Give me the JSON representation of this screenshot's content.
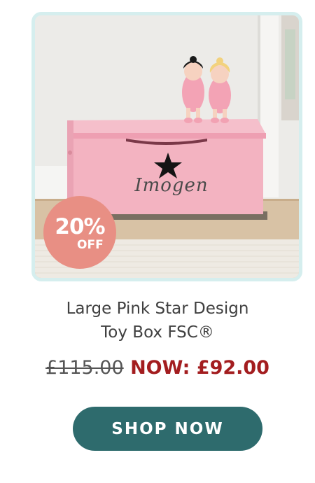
{
  "product": {
    "title_line1": "Large Pink Star Design",
    "title_line2": "Toy Box FSC®",
    "box_name_text": "Imogen"
  },
  "badge": {
    "percent": "20%",
    "off": "OFF"
  },
  "price": {
    "old": "£115.00",
    "new": "NOW: £92.00"
  },
  "cta": {
    "label": "SHOP NOW"
  },
  "colors": {
    "accent": "#2e6b6d",
    "sale_price": "#a31d1f",
    "badge": "#e88f84",
    "image_border": "#d5eeee"
  }
}
